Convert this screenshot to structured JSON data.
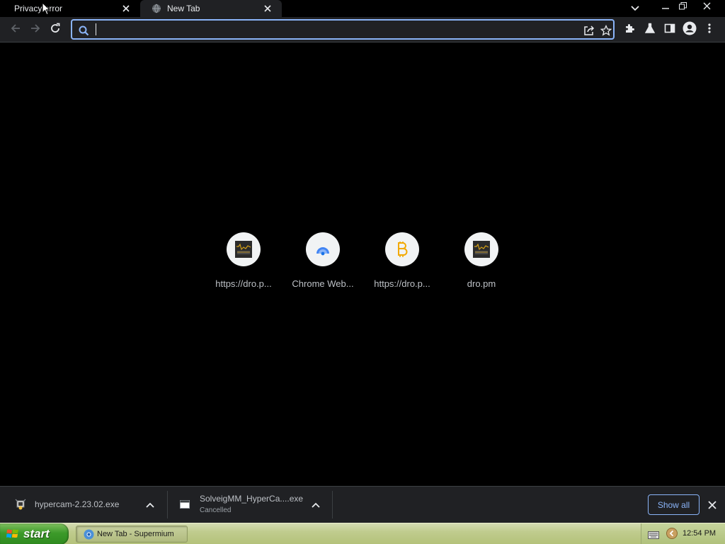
{
  "tabs": [
    {
      "title": "Privacy error",
      "active": false
    },
    {
      "title": "New Tab",
      "active": true
    }
  ],
  "omnibox": {
    "value": "",
    "placeholder": ""
  },
  "shortcuts": [
    {
      "label": "https://dro.p...",
      "icon": "dro-site-icon"
    },
    {
      "label": "Chrome Web...",
      "icon": "chrome-web-store-icon"
    },
    {
      "label": "https://dro.p...",
      "icon": "bitcoin-b-icon"
    },
    {
      "label": "dro.pm",
      "icon": "dro-site-icon"
    }
  ],
  "downloads": [
    {
      "name": "hypercam-2.23.02.exe",
      "status": "",
      "icon": "installer-icon"
    },
    {
      "name": "SolveigMM_HyperCa....exe",
      "status": "Cancelled",
      "icon": "window-file-icon"
    }
  ],
  "download_shelf": {
    "show_all_label": "Show all"
  },
  "taskbar": {
    "start_label": "start",
    "task_label": "New Tab - Supermium",
    "clock": "12:54 PM"
  },
  "colors": {
    "accent": "#8ab4f8",
    "toolbar_bg": "#202124",
    "page_bg": "#000000",
    "xp_start_green": "#3c9a2a",
    "xp_taskbar": "#c0cc8e"
  }
}
